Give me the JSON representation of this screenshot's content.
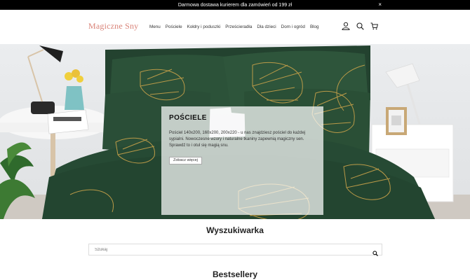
{
  "topbar": {
    "message": "Darmowa dostawa kurierem dla zamówień od 199 zł",
    "close_label": "×"
  },
  "header": {
    "logo": "Magiczne Sny",
    "nav": [
      "Menu",
      "Pościele",
      "Kołdry i poduszki",
      "Prześcieradła",
      "Dla dzieci",
      "Dom i ogród",
      "Blog"
    ],
    "icons": [
      "user-icon",
      "search-icon",
      "cart-icon"
    ]
  },
  "hero": {
    "title": "POŚCIELE",
    "text": "Pościel 140x200, 160x200, 200x220 - u nas znajdziesz pościel do każdej sypialni. Nowoczesne wzory i naturalne tkaniny zapewnią magiczny sen. Sprawdź to i otul się magią snu.",
    "button": "Zobacz więcej"
  },
  "search": {
    "title": "Wyszukiwarka",
    "placeholder": "Szukaj"
  },
  "bestsellers": {
    "title": "Bestsellery"
  },
  "colors": {
    "logo": "#d98277",
    "bedding": "#264a34",
    "leaf_gold": "#c9a24a",
    "topbar": "#000000"
  }
}
